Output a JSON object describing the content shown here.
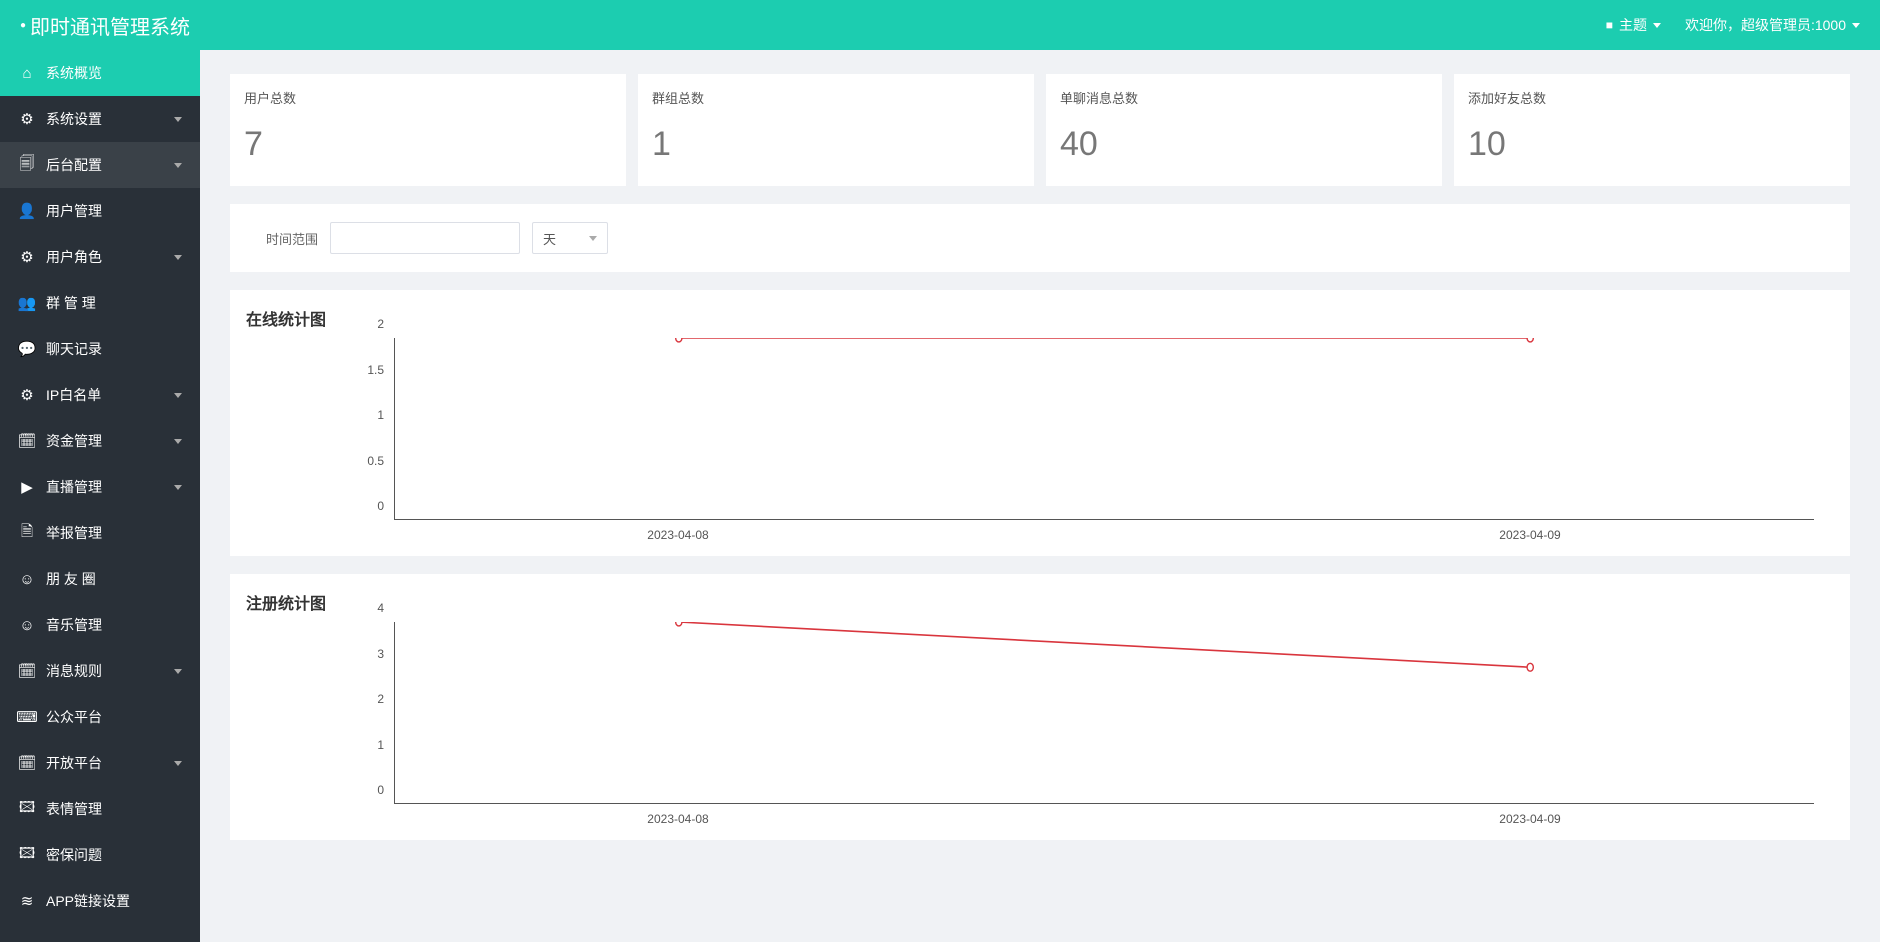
{
  "header": {
    "app_title": "即时通讯管理系统",
    "theme_label": "主题",
    "welcome_text": "欢迎你，超级管理员:1000"
  },
  "sidebar": {
    "items": [
      {
        "icon": "⌂",
        "label": "系统概览",
        "caret": false,
        "active": true
      },
      {
        "icon": "⚙",
        "label": "系统设置",
        "caret": true
      },
      {
        "icon": "🗐",
        "label": "后台配置",
        "caret": true,
        "highlight": true
      },
      {
        "icon": "👤",
        "label": "用户管理",
        "caret": false
      },
      {
        "icon": "⚙",
        "label": "用户角色",
        "caret": true
      },
      {
        "icon": "👥",
        "label": "群 管 理",
        "caret": false
      },
      {
        "icon": "💬",
        "label": "聊天记录",
        "caret": false
      },
      {
        "icon": "⚙",
        "label": "IP白名单",
        "caret": true
      },
      {
        "icon": "🗓",
        "label": "资金管理",
        "caret": true
      },
      {
        "icon": "▶",
        "label": "直播管理",
        "caret": true
      },
      {
        "icon": "🗎",
        "label": "举报管理",
        "caret": false
      },
      {
        "icon": "☺",
        "label": "朋 友 圈",
        "caret": false
      },
      {
        "icon": "☺",
        "label": "音乐管理",
        "caret": false
      },
      {
        "icon": "🗓",
        "label": "消息规则",
        "caret": true
      },
      {
        "icon": "⌨",
        "label": "公众平台",
        "caret": false
      },
      {
        "icon": "🗓",
        "label": "开放平台",
        "caret": true
      },
      {
        "icon": "🖾",
        "label": "表情管理",
        "caret": false
      },
      {
        "icon": "🖾",
        "label": "密保问题",
        "caret": false
      },
      {
        "icon": "≋",
        "label": "APP链接设置",
        "caret": false
      }
    ]
  },
  "stats": [
    {
      "label": "用户总数",
      "value": "7"
    },
    {
      "label": "群组总数",
      "value": "1"
    },
    {
      "label": "单聊消息总数",
      "value": "40"
    },
    {
      "label": "添加好友总数",
      "value": "10"
    }
  ],
  "filter": {
    "range_label": "时间范围",
    "select_value": "天"
  },
  "charts_titles": {
    "online": "在线统计图",
    "register": "注册统计图"
  },
  "chart_data": [
    {
      "type": "line",
      "title": "在线统计图",
      "xlabel": "",
      "ylabel": "",
      "categories": [
        "2023-04-08",
        "2023-04-09"
      ],
      "values": [
        2,
        2
      ],
      "ylim": [
        0,
        2
      ],
      "yticks": [
        0,
        0.5,
        1,
        1.5,
        2
      ]
    },
    {
      "type": "line",
      "title": "注册统计图",
      "xlabel": "",
      "ylabel": "",
      "categories": [
        "2023-04-08",
        "2023-04-09"
      ],
      "values": [
        4,
        3
      ],
      "ylim": [
        0,
        4
      ],
      "yticks": [
        0,
        1,
        2,
        3,
        4
      ]
    }
  ]
}
